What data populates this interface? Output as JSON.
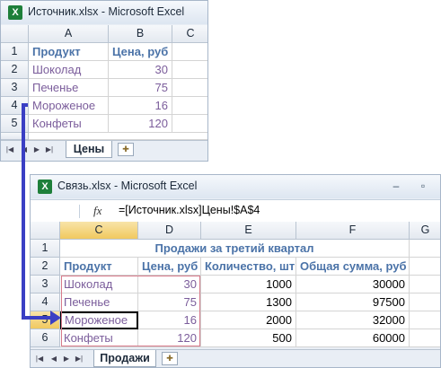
{
  "source_window": {
    "title": "Источник.xlsx - Microsoft Excel",
    "app_icon": "excel-icon",
    "columns": [
      "A",
      "B",
      "C"
    ],
    "rows": [
      {
        "num": "1",
        "a": "Продукт",
        "b": "Цена, руб"
      },
      {
        "num": "2",
        "a": "Шоколад",
        "b": "30"
      },
      {
        "num": "3",
        "a": "Печенье",
        "b": "75"
      },
      {
        "num": "4",
        "a": "Мороженое",
        "b": "16"
      },
      {
        "num": "5",
        "a": "Конфеты",
        "b": "120"
      }
    ],
    "sheet_tab": "Цены"
  },
  "target_window": {
    "title": "Связь.xlsx - Microsoft Excel",
    "app_icon": "excel-icon",
    "formula_label": "fx",
    "formula": "=[Источник.xlsx]Цены!$A$4",
    "columns": [
      "C",
      "D",
      "E",
      "F",
      "G"
    ],
    "selected_column": "C",
    "selected_row": "4",
    "rows": [
      {
        "num": "1",
        "title": "Продажи за третий квартал"
      },
      {
        "num": "2",
        "c": "Продукт",
        "d": "Цена, руб",
        "e": "Количество, шт",
        "f": "Общая сумма, руб"
      },
      {
        "num": "3",
        "c": "Шоколад",
        "d": "30",
        "e": "1000",
        "f": "30000"
      },
      {
        "num": "4",
        "c": "Печенье",
        "d": "75",
        "e": "1300",
        "f": "97500"
      },
      {
        "num": "5",
        "c": "Мороженое",
        "d": "16",
        "e": "2000",
        "f": "32000"
      },
      {
        "num": "6",
        "c": "Конфеты",
        "d": "120",
        "e": "500",
        "f": "60000"
      }
    ],
    "sheet_tab": "Продажи"
  },
  "colors": {
    "header_blue": "#4b73a8",
    "linked_purple": "#7b5d9b",
    "arrow": "#3a3fc4",
    "link_border": "#d77a8a"
  }
}
